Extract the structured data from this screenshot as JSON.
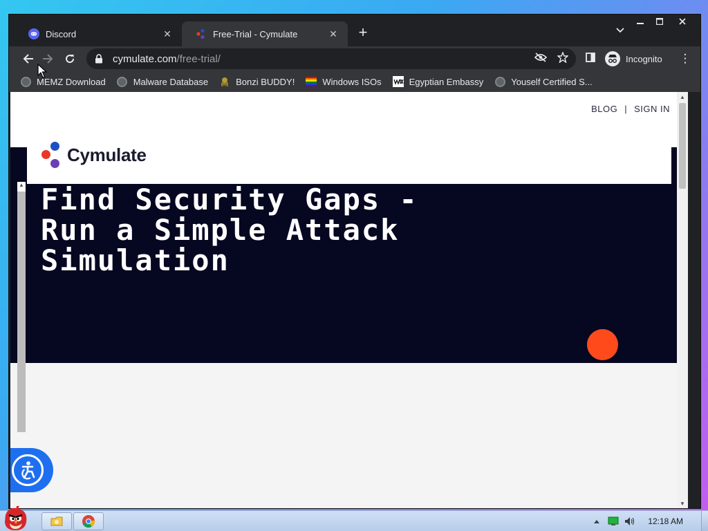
{
  "window": {
    "controls": {
      "minimize": "—",
      "maximize": "☐",
      "close": "✕"
    }
  },
  "tabs": [
    {
      "title": "Discord",
      "icon": "discord-icon",
      "active": false,
      "close": "✕"
    },
    {
      "title": "Free-Trial - Cymulate",
      "icon": "cymulate-icon",
      "active": true,
      "close": "✕"
    }
  ],
  "new_tab": "+",
  "tab_search": "⌄",
  "toolbar": {
    "back": "←",
    "forward": "→",
    "reload": "↻",
    "url_host": "cymulate.com",
    "url_path": "/free-trial/",
    "incognito_label": "Incognito",
    "menu": "⋮"
  },
  "bookmarks": [
    {
      "label": "MEMZ Download",
      "icon": "globe-icon"
    },
    {
      "label": "Malware Database",
      "icon": "globe-icon"
    },
    {
      "label": "Bonzi BUDDY!",
      "icon": "bonzi-icon"
    },
    {
      "label": "Windows ISOs",
      "icon": "rainbow-flag-icon"
    },
    {
      "label": "Egyptian Embassy",
      "icon": "wix-icon"
    },
    {
      "label": "Youself Certified S...",
      "icon": "globe-icon"
    }
  ],
  "page": {
    "top_links": {
      "blog": "BLOG",
      "divider": "|",
      "sign_in": "SIGN IN"
    },
    "brand": "Cymulate",
    "headline": [
      "Find Security Gaps -",
      "Run a Simple Attack",
      "Simulation"
    ],
    "colors": {
      "hero_bg": "#060721",
      "accent_orange": "#ff4a1c",
      "logo_red": "#e8382a",
      "logo_blue": "#1c4fc4",
      "logo_purple": "#6b3fb5",
      "a11y_blue": "#1e6ff0"
    }
  },
  "taskbar": {
    "clock": "12:18 AM"
  }
}
